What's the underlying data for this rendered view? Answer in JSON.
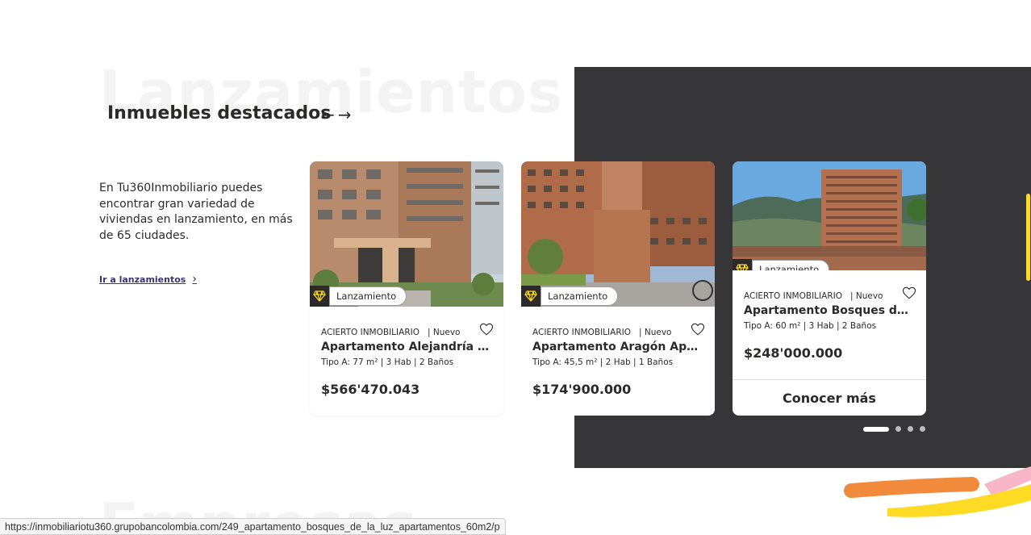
{
  "background_words": {
    "top": "Lanzamientos",
    "bottom": "Empresas"
  },
  "section": {
    "title": "Inmuebles destacados",
    "prev_arrow": "←",
    "next_arrow": "→",
    "intro_text": "En Tu360Inmobiliario puedes encontrar gran variedad de viviendas en lanzamiento, en más de 65 ciudades.",
    "link_label": "Ir a lanzamientos",
    "link_chevron": "›"
  },
  "cards": [
    {
      "badge": "Lanzamiento",
      "company": "ACIERTO INMOBILIARIO",
      "status": "| Nuevo",
      "title": "Apartamento Alejandría Apartamentos",
      "specs": "Tipo A: 77 m² | 3 Hab | 2 Baños",
      "price": "$566'470.043"
    },
    {
      "badge": "Lanzamiento",
      "company": "ACIERTO INMOBILIARIO",
      "status": "| Nuevo",
      "title": "Apartamento Aragón Apartamentos",
      "specs": "Tipo A: 45,5 m² | 2 Hab | 1 Baños",
      "price": "$174'900.000"
    },
    {
      "badge": "Lanzamiento",
      "company": "ACIERTO INMOBILIARIO",
      "status": "| Nuevo",
      "title": "Apartamento Bosques de la Luz",
      "specs": "Tipo A: 60 m² | 3 Hab | 2 Baños",
      "price": "$248'000.000",
      "cta": "Conocer más"
    }
  ],
  "carousel": {
    "pages": 4,
    "active_page": 1
  },
  "browser_status_url": "https://inmobiliariotu360.grupobancolombia.com/249_apartamento_bosques_de_la_luz_apartamentos_60m2/p",
  "colors": {
    "dark_panel": "#363537",
    "brand_yellow": "#fdda24",
    "text": "#2c2a29",
    "link": "#3c3470",
    "deco_orange": "#f28a3b",
    "deco_pink": "#f7b7c9"
  },
  "icons": [
    "gem-icon",
    "heart-icon",
    "arrow-left-icon",
    "arrow-right-icon",
    "chevron-right-icon"
  ]
}
